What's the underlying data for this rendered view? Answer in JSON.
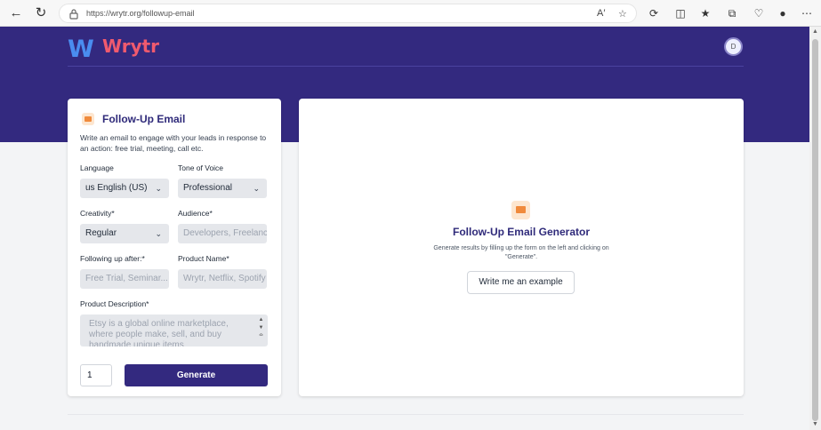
{
  "browser": {
    "url": "https://wrytr.org/followup-email",
    "back_icon": "arrow-left",
    "reload_icon": "reload",
    "menu_icon": "ellipsis"
  },
  "header": {
    "logo_mark": "W",
    "logo_text": "Wrytr",
    "avatar_initial": "D"
  },
  "form": {
    "title": "Follow-Up Email",
    "description": "Write an email to engage with your leads in response to an action: free trial, meeting, call etc.",
    "language_label": "Language",
    "language_value": "us English (US)",
    "tone_label": "Tone of Voice",
    "tone_value": "Professional",
    "creativity_label": "Creativity*",
    "creativity_value": "Regular",
    "audience_label": "Audience*",
    "audience_placeholder": "Developers, Freelancers",
    "following_label": "Following up after:*",
    "following_placeholder": "Free Trial, Seminar...",
    "product_label": "Product Name*",
    "product_placeholder": "Wrytr, Netflix, Spotify",
    "description_label": "Product Description*",
    "description_placeholder": "Etsy is a global online marketplace, where people make, sell, and buy handmade unique items",
    "quantity": "1",
    "generate_label": "Generate"
  },
  "result": {
    "title": "Follow-Up Email Generator",
    "subtitle": "Generate results by filling up the form on the left and clicking on \"Generate\".",
    "example_button": "Write me an example"
  },
  "colors": {
    "brand": "#33297f",
    "logo_blue": "#4a8df0",
    "logo_red": "#f05a6e",
    "accent_orange": "#f08a3c"
  }
}
